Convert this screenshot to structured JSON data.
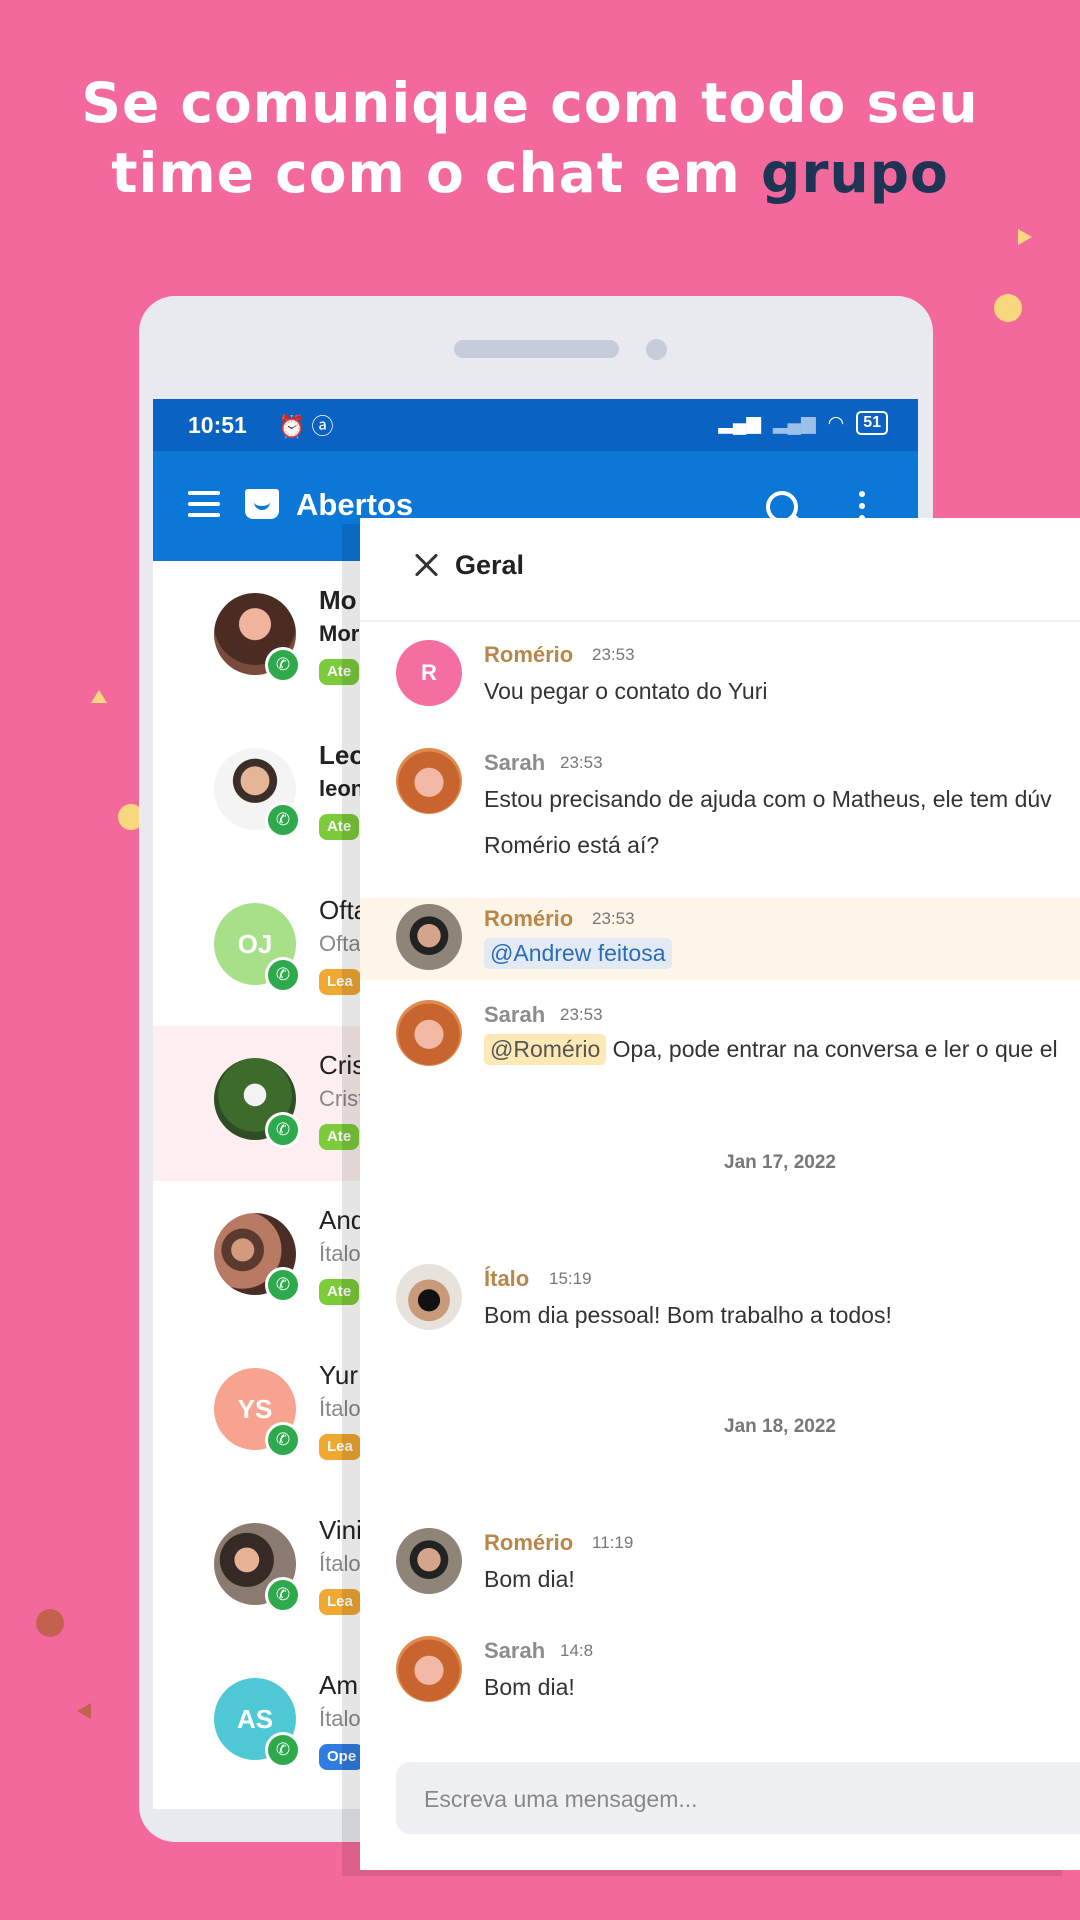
{
  "headline": {
    "line1": "Se comunique com todo seu",
    "line2_prefix": "time com o chat em ",
    "line2_accent": "grupo"
  },
  "colors": {
    "background": "#F4699B",
    "accent_text": "#1E3454",
    "appbar": "#0B77D6",
    "statusbar": "#0A63C2",
    "whatsapp": "#2EAA4C"
  },
  "status_bar": {
    "time": "10:51",
    "icons_left": [
      "alarm-icon",
      "app-icon"
    ],
    "icons_right": [
      "signal-icon",
      "signal-icon",
      "wifi-icon",
      "battery-icon"
    ],
    "battery": "51"
  },
  "app_bar": {
    "title": "Abertos",
    "icons": [
      "menu-icon",
      "inbox-icon",
      "search-icon",
      "more-icon"
    ]
  },
  "conversations": [
    {
      "name": "Mo",
      "sub": "Mor",
      "tag": "Ate",
      "tag_color": "#7BCB3A",
      "avatar": "photo-woman",
      "bold": true
    },
    {
      "name": "Leo",
      "sub": "leon",
      "tag": "Ate",
      "tag_color": "#7BCB3A",
      "avatar": "photo-man",
      "bold": true
    },
    {
      "name": "Ofta",
      "sub": "Ofta",
      "tag": "Lea",
      "tag_color": "#F0A830",
      "avatar_initials": "OJ",
      "avatar_color": "#A8E08A",
      "bold": false
    },
    {
      "name": "Cris",
      "sub": "Crist",
      "tag": "Ate",
      "tag_color": "#7BCB3A",
      "avatar": "photo-green",
      "bold": false,
      "selected": true
    },
    {
      "name": "And",
      "sub": "Ítalo",
      "tag": "Ate",
      "tag_color": "#7BCB3A",
      "avatar": "photo-group",
      "bold": false
    },
    {
      "name": "Yur",
      "sub": "Ítalo",
      "tag": "Lea",
      "tag_color": "#F0A830",
      "avatar_initials": "YS",
      "avatar_color": "#F8A38F",
      "bold": false
    },
    {
      "name": "Vini",
      "sub": "Ítalo",
      "tag": "Lea",
      "tag_color": "#F0A830",
      "avatar": "photo-couple",
      "bold": false
    },
    {
      "name": "Am",
      "sub": "Ítalo",
      "tag": "Ope",
      "tag_color": "#2F7DE0",
      "avatar_initials": "AS",
      "avatar_color": "#4FC8D6",
      "bold": false
    }
  ],
  "chat": {
    "title": "Geral",
    "messages": [
      {
        "author": "Romério",
        "time": "23:53",
        "text": "Vou pegar o contato do Yuri",
        "avatar_initials": "R"
      },
      {
        "author": "Sarah",
        "time": "23:53",
        "text": "Estou precisando de ajuda com o Matheus, ele tem dúv",
        "text2": "Romério está aí?"
      },
      {
        "author": "Romério",
        "time": "23:53",
        "mention": "@Andrew feitosa"
      },
      {
        "author": "Sarah",
        "time": "23:53",
        "mention": "@Romério",
        "text": "Opa, pode entrar na conversa e ler o que el"
      },
      {
        "author": "Ítalo",
        "time": "15:19",
        "text": "Bom dia pessoal! Bom trabalho a todos!"
      },
      {
        "author": "Romério",
        "time": "11:19",
        "text": "Bom dia!"
      },
      {
        "author": "Sarah",
        "time": "14:8",
        "text": "Bom dia!"
      }
    ],
    "date_separators": [
      "Jan 17, 2022",
      "Jan 18, 2022"
    ],
    "composer_placeholder": "Escreva uma mensagem..."
  }
}
